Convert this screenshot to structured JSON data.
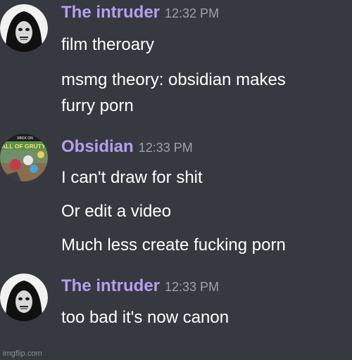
{
  "messages": [
    {
      "author": "The intruder",
      "time": "12:32 PM",
      "avatar_icon": "hooded-figure-avatar",
      "lines": [
        "film theroary",
        "msmg theory: obsidian makes",
        "furry porn"
      ]
    },
    {
      "author": "Obsidian",
      "time": "12:33 PM",
      "avatar_icon": "game-cover-avatar",
      "avatar_text": [
        "XBOX ON",
        "ALL OF GRUTY"
      ],
      "lines": [
        "I can't draw for shit",
        "Or edit a video",
        "Much less create fucking porn"
      ]
    },
    {
      "author": "The intruder",
      "time": "12:33 PM",
      "avatar_icon": "hooded-figure-avatar",
      "lines": [
        "too bad it's now canon"
      ]
    }
  ],
  "watermark": "imgflip.com",
  "colors": {
    "background": "#36393f",
    "username": "#b79ef0",
    "timestamp": "#9ea2a8",
    "message_text": "#ffffff"
  }
}
